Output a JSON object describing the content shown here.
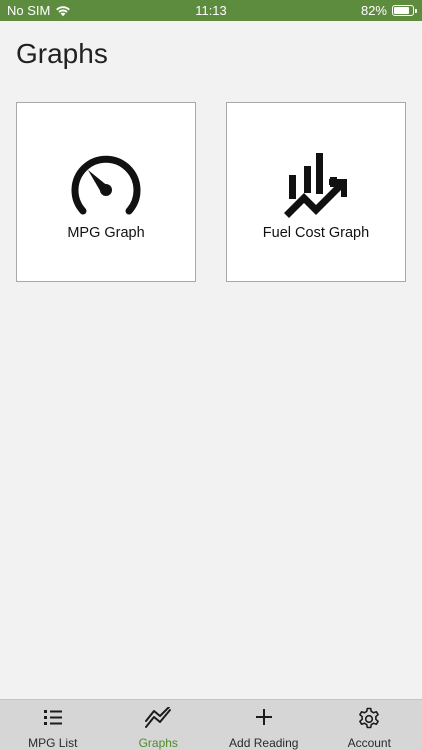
{
  "status_bar": {
    "carrier": "No SIM",
    "time": "11:13",
    "battery_percent": "82%",
    "battery_level": 0.82
  },
  "page": {
    "title": "Graphs"
  },
  "tiles": [
    {
      "label": "MPG Graph",
      "icon": "speedometer-icon"
    },
    {
      "label": "Fuel Cost Graph",
      "icon": "bar-chart-trend-icon"
    }
  ],
  "tab_bar": {
    "active_index": 1,
    "items": [
      {
        "label": "MPG List",
        "icon": "list-icon"
      },
      {
        "label": "Graphs",
        "icon": "line-graph-icon"
      },
      {
        "label": "Add Reading",
        "icon": "plus-icon"
      },
      {
        "label": "Account",
        "icon": "gear-icon"
      }
    ]
  },
  "colors": {
    "status_bar": "#5e8c3e",
    "accent": "#4f8a2a",
    "tab_bar": "#d6d6d6",
    "background": "#f2f2f2"
  }
}
